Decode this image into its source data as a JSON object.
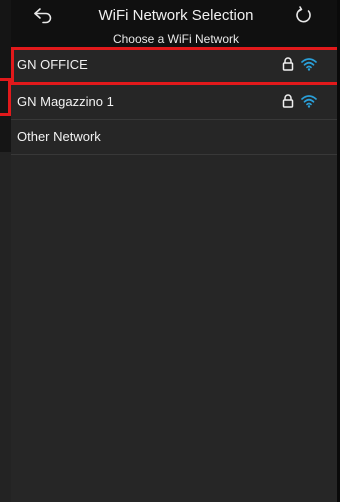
{
  "header": {
    "title": "WiFi Network Selection",
    "subtitle": "Choose a WiFi Network",
    "back_icon": "back-arrow-icon",
    "refresh_icon": "refresh-icon"
  },
  "networks": [
    {
      "name": "GN OFFICE",
      "secured": true,
      "signal_icon": "wifi-icon",
      "selected": true
    },
    {
      "name": "GN Magazzino 1",
      "secured": true,
      "signal_icon": "wifi-icon",
      "selected": false
    },
    {
      "name": "Other Network",
      "secured": false,
      "selected": false
    }
  ],
  "colors": {
    "accent_highlight": "#e1191b",
    "wifi_blue": "#2a9fd8",
    "background": "#262626",
    "header_background": "#101010"
  }
}
